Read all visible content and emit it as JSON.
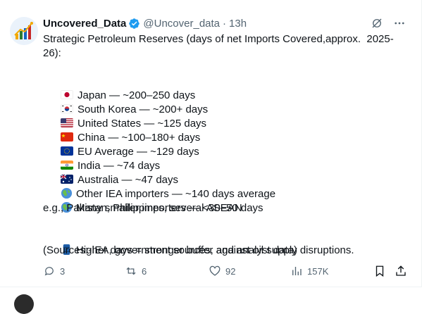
{
  "tweet": {
    "author_name": "Uncovered_Data",
    "handle": "@Uncover_data",
    "separator": "·",
    "time": "13h",
    "lines": [
      "Strategic Petroleum Reserves (days of net Imports Covered,approx.  2025-",
      "26):",
      "",
      "Japan — ~200–250 days",
      "South Korea — ~200+ days",
      "United States — ~125 days",
      "China — ~100–180+ days",
      "EU Average — ~129 days",
      "India — ~74 days",
      "Australia — ~47 days",
      "Other IEA importers — ~140 days average",
      "Many smaller importers — <30–50 days",
      "e.g., Pakistan, Philippines, several ASEAN",
      "",
      "Higher days = stronger buffer against oil supply disruptions.",
      "(Sources:-IEA, government sources, and analyst data)"
    ],
    "line_icons": [
      "",
      "",
      "",
      "flag-japan-icon",
      "flag-south-korea-icon",
      "flag-united-states-icon",
      "flag-china-icon",
      "flag-eu-icon",
      "flag-india-icon",
      "flag-australia-icon",
      "globe-icon",
      "globe-icon",
      "",
      "",
      "oil-barrel-icon",
      ""
    ],
    "actions": {
      "replies": "3",
      "reposts": "6",
      "likes": "92",
      "views": "157K"
    },
    "colors": {
      "text": "#0f1419",
      "muted": "#536471",
      "verified": "#1d9bf0"
    }
  }
}
